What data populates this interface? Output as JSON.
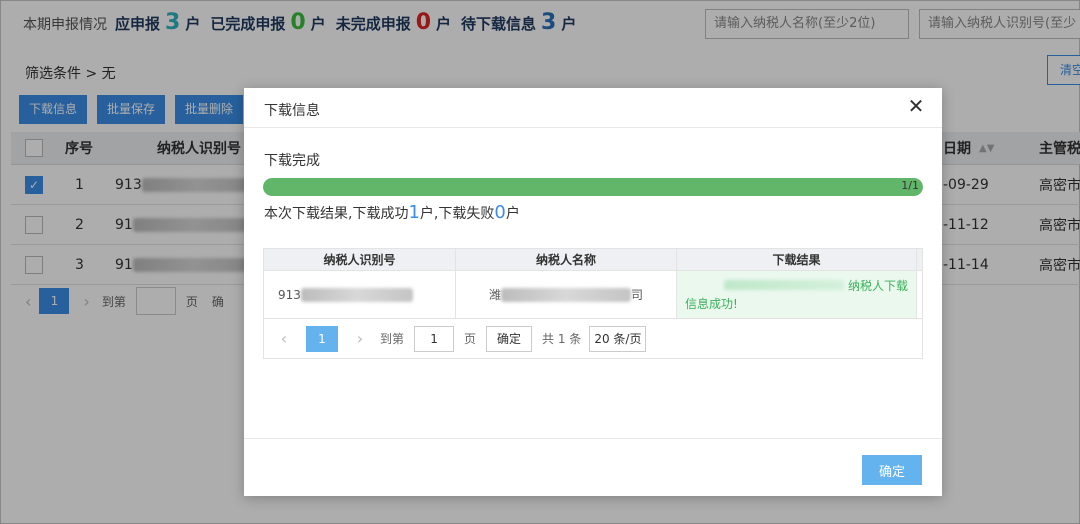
{
  "stats": {
    "label": "本期申报情况",
    "items": [
      {
        "prefix": "应申报",
        "num": "3",
        "suffix": "户",
        "color": "#2bb3c0"
      },
      {
        "prefix": "已完成申报",
        "num": "0",
        "suffix": "户",
        "color": "#3bbf3b"
      },
      {
        "prefix": "未完成申报",
        "num": "0",
        "suffix": "户",
        "color": "#e02424"
      },
      {
        "prefix": "待下载信息",
        "num": "3",
        "suffix": "户",
        "color": "#2a6fb8"
      }
    ]
  },
  "search": {
    "name_placeholder": "请输入纳税人名称(至少2位)",
    "id_placeholder": "请输入纳税人识别号(至少"
  },
  "filter": {
    "label": "筛选条件 > 无",
    "clear_label": "清空"
  },
  "toolbar": {
    "download": "下载信息",
    "batch_save": "批量保存",
    "batch_delete": "批量删除"
  },
  "table": {
    "headers": {
      "index": "序号",
      "tax_id": "纳税人识别号",
      "date": "日期",
      "authority": "主管税"
    },
    "rows": [
      {
        "index": "1",
        "id_prefix": "913",
        "date": "-09-29",
        "authority": "高密市",
        "checked": true
      },
      {
        "index": "2",
        "id_prefix": "91",
        "date": "-11-12",
        "authority": "高密市",
        "checked": false
      },
      {
        "index": "3",
        "id_prefix": "91",
        "date": "-11-14",
        "authority": "高密市",
        "checked": false
      }
    ]
  },
  "bg_pager": {
    "page": "1",
    "goto": "到第",
    "page_unit": "页",
    "confirm": "确"
  },
  "modal": {
    "title": "下载信息",
    "status": "下载完成",
    "progress": {
      "fraction": 1.0,
      "label": "1/1"
    },
    "result": {
      "text1": "本次下载结果,下载成功",
      "success": "1",
      "text2": "户,下载失败",
      "failed": "0",
      "text3": "户"
    },
    "table": {
      "headers": [
        "纳税人识别号",
        "纳税人名称",
        "下载结果"
      ],
      "rows": [
        {
          "id_prefix": "913",
          "name_prefix": "潍",
          "name_suffix": "司",
          "result_1": "纳税人下载",
          "result_2": "信息成功!"
        }
      ]
    },
    "pager": {
      "page": "1",
      "goto": "到第",
      "input": "1",
      "unit": "页",
      "confirm": "确定",
      "total": "共 1 条",
      "size": "20 条/页"
    },
    "confirm": "确定"
  }
}
